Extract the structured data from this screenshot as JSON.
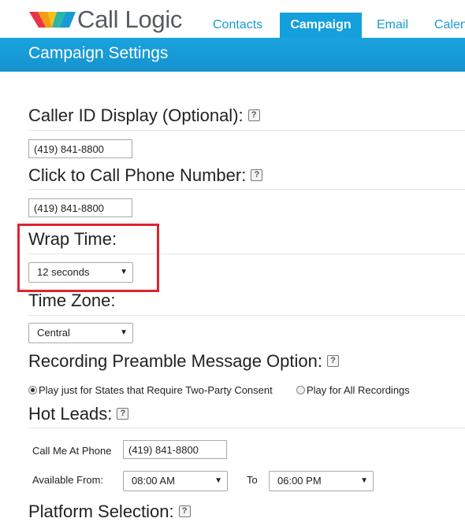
{
  "header": {
    "logo_text": "Call Logic",
    "nav": [
      {
        "label": "Contacts"
      },
      {
        "label": "Campaign"
      },
      {
        "label": "Email"
      },
      {
        "label": "Calendar"
      }
    ],
    "active_tab": "Campaign",
    "page_title": "Campaign Settings"
  },
  "help_glyph": "?",
  "sections": {
    "caller_id": {
      "title": "Caller ID Display (Optional):",
      "value": "(419) 841-8800"
    },
    "click_to_call": {
      "title": "Click to Call Phone Number:",
      "value": "(419) 841-8800"
    },
    "wrap_time": {
      "title": "Wrap Time:",
      "selected": "12 seconds"
    },
    "time_zone": {
      "title": "Time Zone:",
      "selected": "Central"
    },
    "recording_preamble": {
      "title": "Recording Preamble Message Option:",
      "options": [
        {
          "label": "Play just for States that Require Two-Party Consent",
          "checked": true
        },
        {
          "label": "Play for All Recordings",
          "checked": false
        }
      ]
    },
    "hot_leads": {
      "title": "Hot Leads:",
      "call_me_label": "Call Me At Phone",
      "call_me_value": "(419) 841-8800",
      "available_from_label": "Available From:",
      "from_value": "08:00 AM",
      "to_label": "To",
      "to_value": "06:00 PM"
    },
    "platform": {
      "title": "Platform Selection:"
    }
  },
  "colors": {
    "brand_blue": "#13a0dc",
    "highlight_red": "#e0222e"
  }
}
